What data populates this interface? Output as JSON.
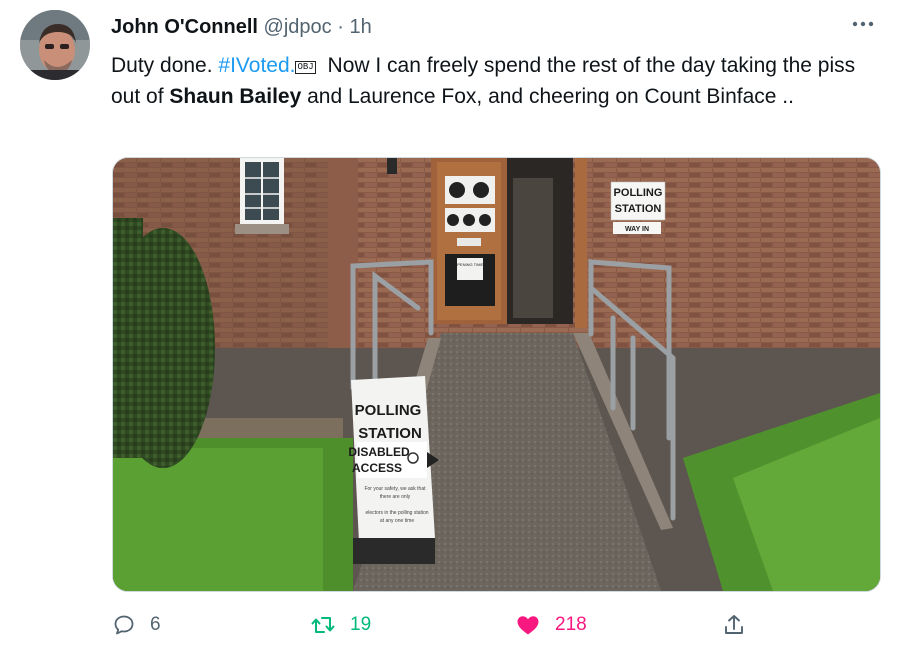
{
  "tweet": {
    "author_name": "John O'Connell",
    "handle": "@jdpoc",
    "separator": "·",
    "time": "1h",
    "text": {
      "part1": "Duty done. ",
      "hashtag": "#IVoted",
      "dot": ".",
      "emoji_code": "OBJ",
      "part2": " Now I can freely spend the rest of the day taking the piss out of ",
      "bold_name": "Shaun Bailey",
      "part3": " and Laurence Fox, and cheering on Count Binface .."
    }
  },
  "photo": {
    "signs": {
      "door_top_line1": "POLLING",
      "door_top_line2": "STATION",
      "door_top_line3": "WAY IN",
      "board_line1": "POLLING",
      "board_line2": "STATION",
      "board_line3": "DISABLED",
      "board_line4": "ACCESS",
      "board_small1": "For your safety, we ask that",
      "board_small2": "there are only",
      "board_small3": "electors in the polling station",
      "board_small4": "at any one time",
      "opening_times": "OPENING TIMES"
    }
  },
  "actions": {
    "replies": "6",
    "retweets": "19",
    "likes": "218"
  },
  "colors": {
    "retweet": "#00ba7c",
    "like": "#f91880",
    "link": "#1d9bf0",
    "muted": "#536471"
  }
}
